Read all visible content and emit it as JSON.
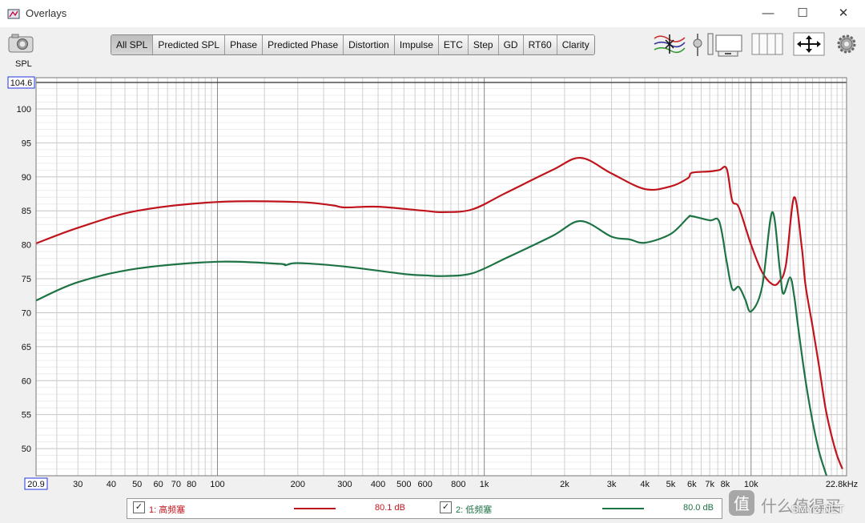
{
  "window": {
    "title": "Overlays"
  },
  "toolbar": {
    "tabs": [
      "All SPL",
      "Predicted SPL",
      "Phase",
      "Predicted Phase",
      "Distortion",
      "Impulse",
      "ETC",
      "Step",
      "GD",
      "RT60",
      "Clarity"
    ],
    "active_tab": "All SPL"
  },
  "chart_data": {
    "type": "line",
    "ylabel": "SPL",
    "x_scale": "log",
    "xlim": [
      20.9,
      22800
    ],
    "ylim": [
      46,
      104.6
    ],
    "y_max_label": "104.6",
    "x_min_label": "20.9",
    "x_max_label": "22.8kHz",
    "y_ticks": [
      "100",
      "95",
      "90",
      "85",
      "80",
      "75",
      "70",
      "65",
      "60",
      "55",
      "50"
    ],
    "x_ticks": [
      "30",
      "40",
      "50",
      "60",
      "70",
      "80",
      "100",
      "200",
      "300",
      "400",
      "500",
      "600",
      "800",
      "1k",
      "2k",
      "3k",
      "4k",
      "5k",
      "6k",
      "7k",
      "8k",
      "10k"
    ],
    "grid": true,
    "series": [
      {
        "name": "1: 高频塞",
        "color": "#c0141c",
        "level": "80.1 dB",
        "x": [
          20.9,
          30,
          50,
          100,
          200,
          270,
          300,
          400,
          600,
          700,
          900,
          1200,
          1800,
          2300,
          3000,
          4000,
          5000,
          5800,
          6000,
          7000,
          7600,
          8100,
          8500,
          9000,
          10000,
          11000,
          12000,
          12700,
          13500,
          14500,
          15500,
          16000,
          17000,
          18000,
          19000,
          20000,
          21000,
          22000
        ],
        "y": [
          80.2,
          82.5,
          85.0,
          86.3,
          86.3,
          85.8,
          85.5,
          85.6,
          85.0,
          84.8,
          85.2,
          87.6,
          91.0,
          92.8,
          90.5,
          88.2,
          88.6,
          89.8,
          90.6,
          90.8,
          91.0,
          91.2,
          86.5,
          85.5,
          80.0,
          76.0,
          74.2,
          74.5,
          77.0,
          87.0,
          79.5,
          74.0,
          68.0,
          62.0,
          56.0,
          52.0,
          49.0,
          47.0
        ]
      },
      {
        "name": "2: 低频塞",
        "color": "#1e7344",
        "level": "80.0 dB",
        "x": [
          20.9,
          30,
          50,
          100,
          170,
          180,
          200,
          300,
          500,
          600,
          700,
          900,
          1200,
          1800,
          2300,
          3000,
          3500,
          4000,
          5000,
          5800,
          6000,
          7000,
          7600,
          8100,
          8500,
          9000,
          9500,
          10000,
          11000,
          12000,
          12800,
          13200,
          14000,
          14500,
          15000,
          16000,
          17000,
          18000,
          19000,
          20000
        ],
        "y": [
          71.8,
          74.5,
          76.5,
          77.5,
          77.2,
          77.0,
          77.3,
          76.8,
          75.7,
          75.5,
          75.4,
          75.8,
          78.0,
          81.3,
          83.5,
          81.2,
          80.8,
          80.3,
          81.6,
          84.0,
          84.2,
          83.6,
          83.4,
          77.5,
          73.5,
          73.8,
          72.0,
          70.2,
          73.8,
          84.8,
          76.5,
          72.8,
          75.2,
          72.5,
          68.0,
          60.0,
          54.0,
          49.5,
          46.5,
          44.0
        ]
      }
    ]
  },
  "legend": {
    "items": [
      {
        "label": "1: 高频塞",
        "value": "80.1 dB",
        "color": "#c0141c",
        "check": "✓"
      },
      {
        "label": "2: 低频塞",
        "value": "80.0 dB",
        "color": "#1e7344",
        "check": "✓"
      }
    ]
  },
  "watermark": {
    "text": "什么值得买",
    "sub": "SMYZ.NET"
  }
}
